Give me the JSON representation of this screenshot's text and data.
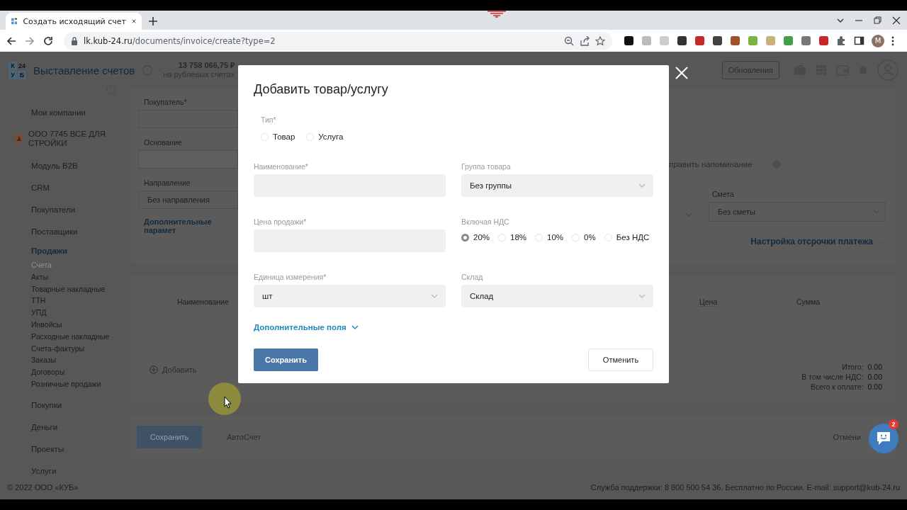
{
  "browser": {
    "tab_title": "Создать исходящий счет",
    "url_host": "lk.kub-24.ru",
    "url_path": "/documents/invoice/create?type=2",
    "profile_initial": "M"
  },
  "app": {
    "header": {
      "logo_letters": [
        "К",
        "24",
        "У",
        "Б"
      ],
      "brand": "Выставление счетов",
      "balance": "13 758 066,75 ₽",
      "balance_caption": "на рублевых счетах",
      "updates_button": "Обновления"
    },
    "sidebar": {
      "items": [
        {
          "kind": "section",
          "label": "Мои компании",
          "selected": false
        },
        {
          "kind": "company",
          "label": "ООО 7745 ВСЕ ДЛЯ СТРОЙКИ",
          "selected": false
        },
        {
          "kind": "section",
          "label": "Модуль B2B",
          "selected": false
        },
        {
          "kind": "section",
          "label": "CRM",
          "selected": false
        },
        {
          "kind": "section",
          "label": "Покупатели",
          "selected": false
        },
        {
          "kind": "section",
          "label": "Поставщики",
          "selected": false
        },
        {
          "kind": "section",
          "label": "Продажи",
          "selected": true,
          "expanded": true,
          "children": [
            {
              "label": "Счета",
              "selected": true
            },
            {
              "label": "Акты",
              "selected": false
            },
            {
              "label": "Товарные накладные",
              "selected": false
            },
            {
              "label": "ТТН",
              "selected": false
            },
            {
              "label": "УПД",
              "selected": false
            },
            {
              "label": "Инвойсы",
              "selected": false
            },
            {
              "label": "Расходные накладные",
              "selected": false
            },
            {
              "label": "Счета-фактуры",
              "selected": false
            },
            {
              "label": "Заказы",
              "selected": false
            },
            {
              "label": "Договоры",
              "selected": false
            },
            {
              "label": "Розничные продажи",
              "selected": false
            }
          ]
        },
        {
          "kind": "section",
          "label": "Покупки",
          "selected": false
        },
        {
          "kind": "section",
          "label": "Деньги",
          "selected": false
        },
        {
          "kind": "section",
          "label": "Проекты",
          "selected": false
        },
        {
          "kind": "section",
          "label": "Услуги",
          "selected": false
        }
      ]
    },
    "form_left": {
      "fields": [
        {
          "label": "Покупатель*"
        },
        {
          "label": "Основание"
        },
        {
          "label": "Направление",
          "placeholder": "Без направления"
        }
      ],
      "link": "Дополнительные парамет"
    },
    "form_right": {
      "reminder": "править напоминание",
      "estimate": {
        "label": "Смета",
        "placeholder": "Без сметы"
      },
      "link": "Настройка отсрочки платежа"
    },
    "table": {
      "columns": [
        "Наименование",
        "Цена",
        "Сумма"
      ],
      "add_button": "Добавить"
    },
    "totals": [
      {
        "label": "Итого:",
        "value": "0.00"
      },
      {
        "label": "В том числе НДС:",
        "value": "0.00"
      },
      {
        "label": "Всего к оплате:",
        "value": "0.00"
      }
    ],
    "actions": {
      "save": "Сохранить",
      "autoinvoice": "АвтоСчет",
      "cancel": "Отмени"
    },
    "footer": {
      "copyright": "© 2022 ООО «КУБ»",
      "support": "Служба поддержки: 8 800 500 54 36. Бесплатно по России. E-mail: support@kub-24.ru"
    }
  },
  "modal": {
    "title": "Добавить товар/услугу",
    "type": {
      "label": "Тип*",
      "options": [
        {
          "label": "Товар",
          "selected": false
        },
        {
          "label": "Услуга",
          "selected": false
        }
      ]
    },
    "fields": [
      {
        "kind": "input",
        "label": "Наименование*"
      },
      {
        "kind": "select",
        "label": "Группа товара",
        "value": "Без группы"
      },
      {
        "kind": "input",
        "label": "Цена продажи*"
      },
      {
        "kind": "radio",
        "label": "Включая НДС",
        "options": [
          {
            "label": "20%",
            "selected": true
          },
          {
            "label": "18%",
            "selected": false
          },
          {
            "label": "10%",
            "selected": false
          },
          {
            "label": "0%",
            "selected": false
          },
          {
            "label": "Без НДС",
            "selected": false
          }
        ]
      },
      {
        "kind": "select",
        "label": "Единица измерения*",
        "value": "шт"
      },
      {
        "kind": "select",
        "label": "Склад",
        "value": "Склад"
      }
    ],
    "more_link": "Дополнительные поля",
    "save": "Сохранить",
    "cancel": "Отменить"
  },
  "chat": {
    "badge": "2"
  }
}
